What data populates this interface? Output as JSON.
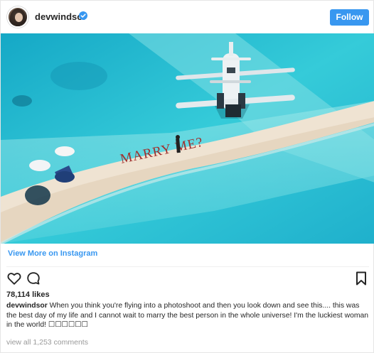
{
  "post": {
    "username": "devwindsor",
    "verified": true,
    "follow_label": "Follow",
    "photo_text": "MARRY ME?",
    "view_more_label": "View More on Instagram",
    "likes": "78,114 likes",
    "caption_user": "devwindsor",
    "caption_text": "When you think you're flying into a photoshoot and then you look down and see this.... this was the best day of my life and I cannot wait to marry the best person in the whole universe! I'm the luckiest woman in the world! ☐☐☐☐☐☐",
    "view_all_comments": "view all 1,253 comments"
  },
  "icons": {
    "like": "heart-icon",
    "comment": "comment-icon",
    "save": "bookmark-icon",
    "verified": "verified-badge-icon"
  },
  "colors": {
    "accent": "#3897f0",
    "text": "#262626",
    "muted": "#999999",
    "sea": "#2ec4d6",
    "sand": "#efe3d2",
    "sign_letters": "#a0302e"
  }
}
